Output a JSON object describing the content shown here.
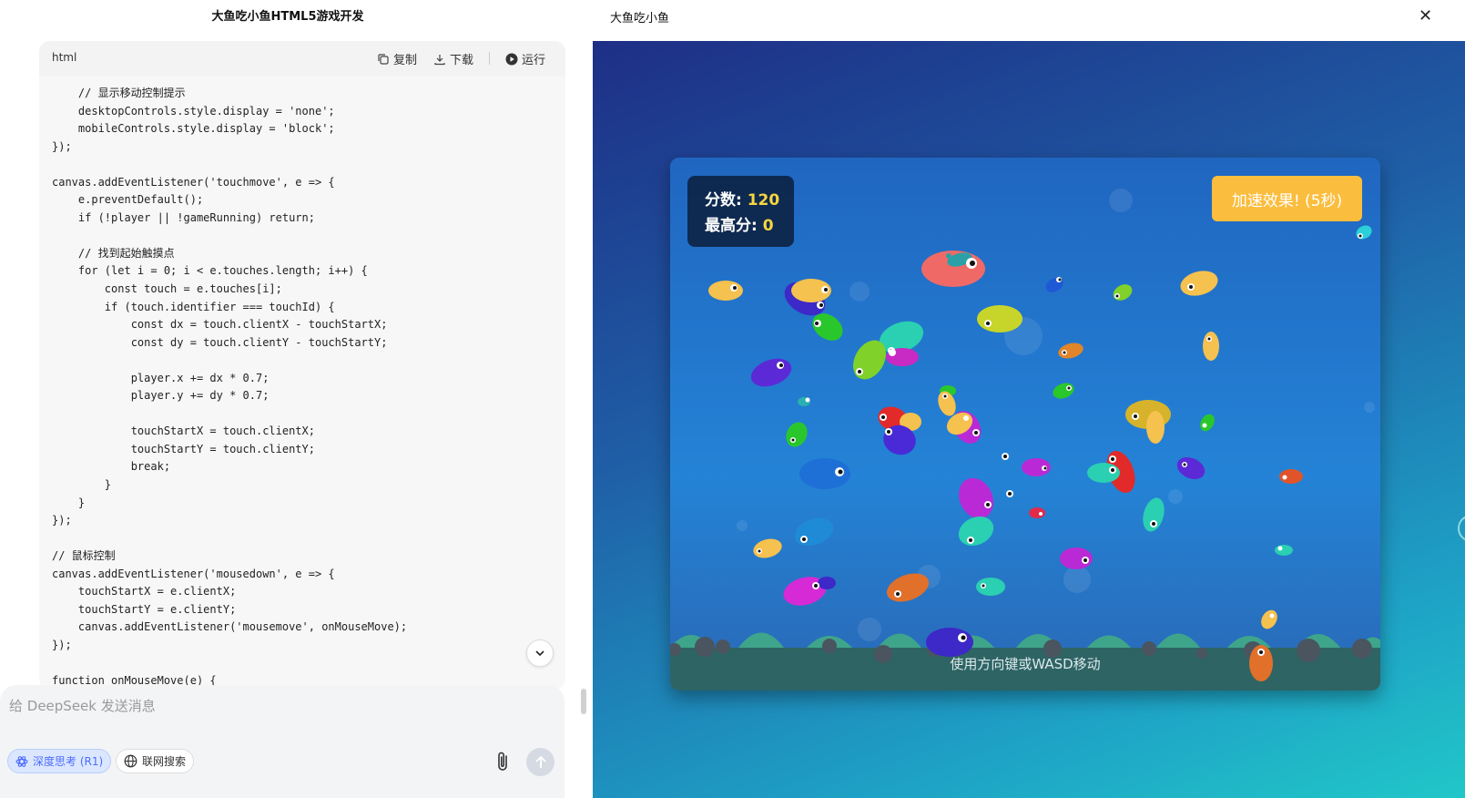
{
  "chat": {
    "title": "大鱼吃小鱼HTML5游戏开发",
    "code_lang": "html",
    "copy_label": "复制",
    "download_label": "下载",
    "run_label": "运行",
    "code": "    // 显示移动控制提示\n    desktopControls.style.display = 'none';\n    mobileControls.style.display = 'block';\n});\n\ncanvas.addEventListener('touchmove', e => {\n    e.preventDefault();\n    if (!player || !gameRunning) return;\n\n    // 找到起始触摸点\n    for (let i = 0; i < e.touches.length; i++) {\n        const touch = e.touches[i];\n        if (touch.identifier === touchId) {\n            const dx = touch.clientX - touchStartX;\n            const dy = touch.clientY - touchStartY;\n\n            player.x += dx * 0.7;\n            player.y += dy * 0.7;\n\n            touchStartX = touch.clientX;\n            touchStartY = touch.clientY;\n            break;\n        }\n    }\n});\n\n// 鼠标控制\ncanvas.addEventListener('mousedown', e => {\n    touchStartX = e.clientX;\n    touchStartY = e.clientY;\n    canvas.addEventListener('mousemove', onMouseMove);\n});\n\nfunction onMouseMove(e) {"
  },
  "input": {
    "placeholder": "给 DeepSeek 发送消息",
    "deep_think_label": "深度思考 (R1)",
    "web_search_label": "联网搜索"
  },
  "preview": {
    "title": "大鱼吃小鱼",
    "close_symbol": "✕"
  },
  "game": {
    "score_label": "分数: ",
    "score_value": "120",
    "high_label": "最高分: ",
    "high_value": "0",
    "boost_text": "加速效果! (5秒)",
    "hint": "使用方向键或WASD移动"
  }
}
